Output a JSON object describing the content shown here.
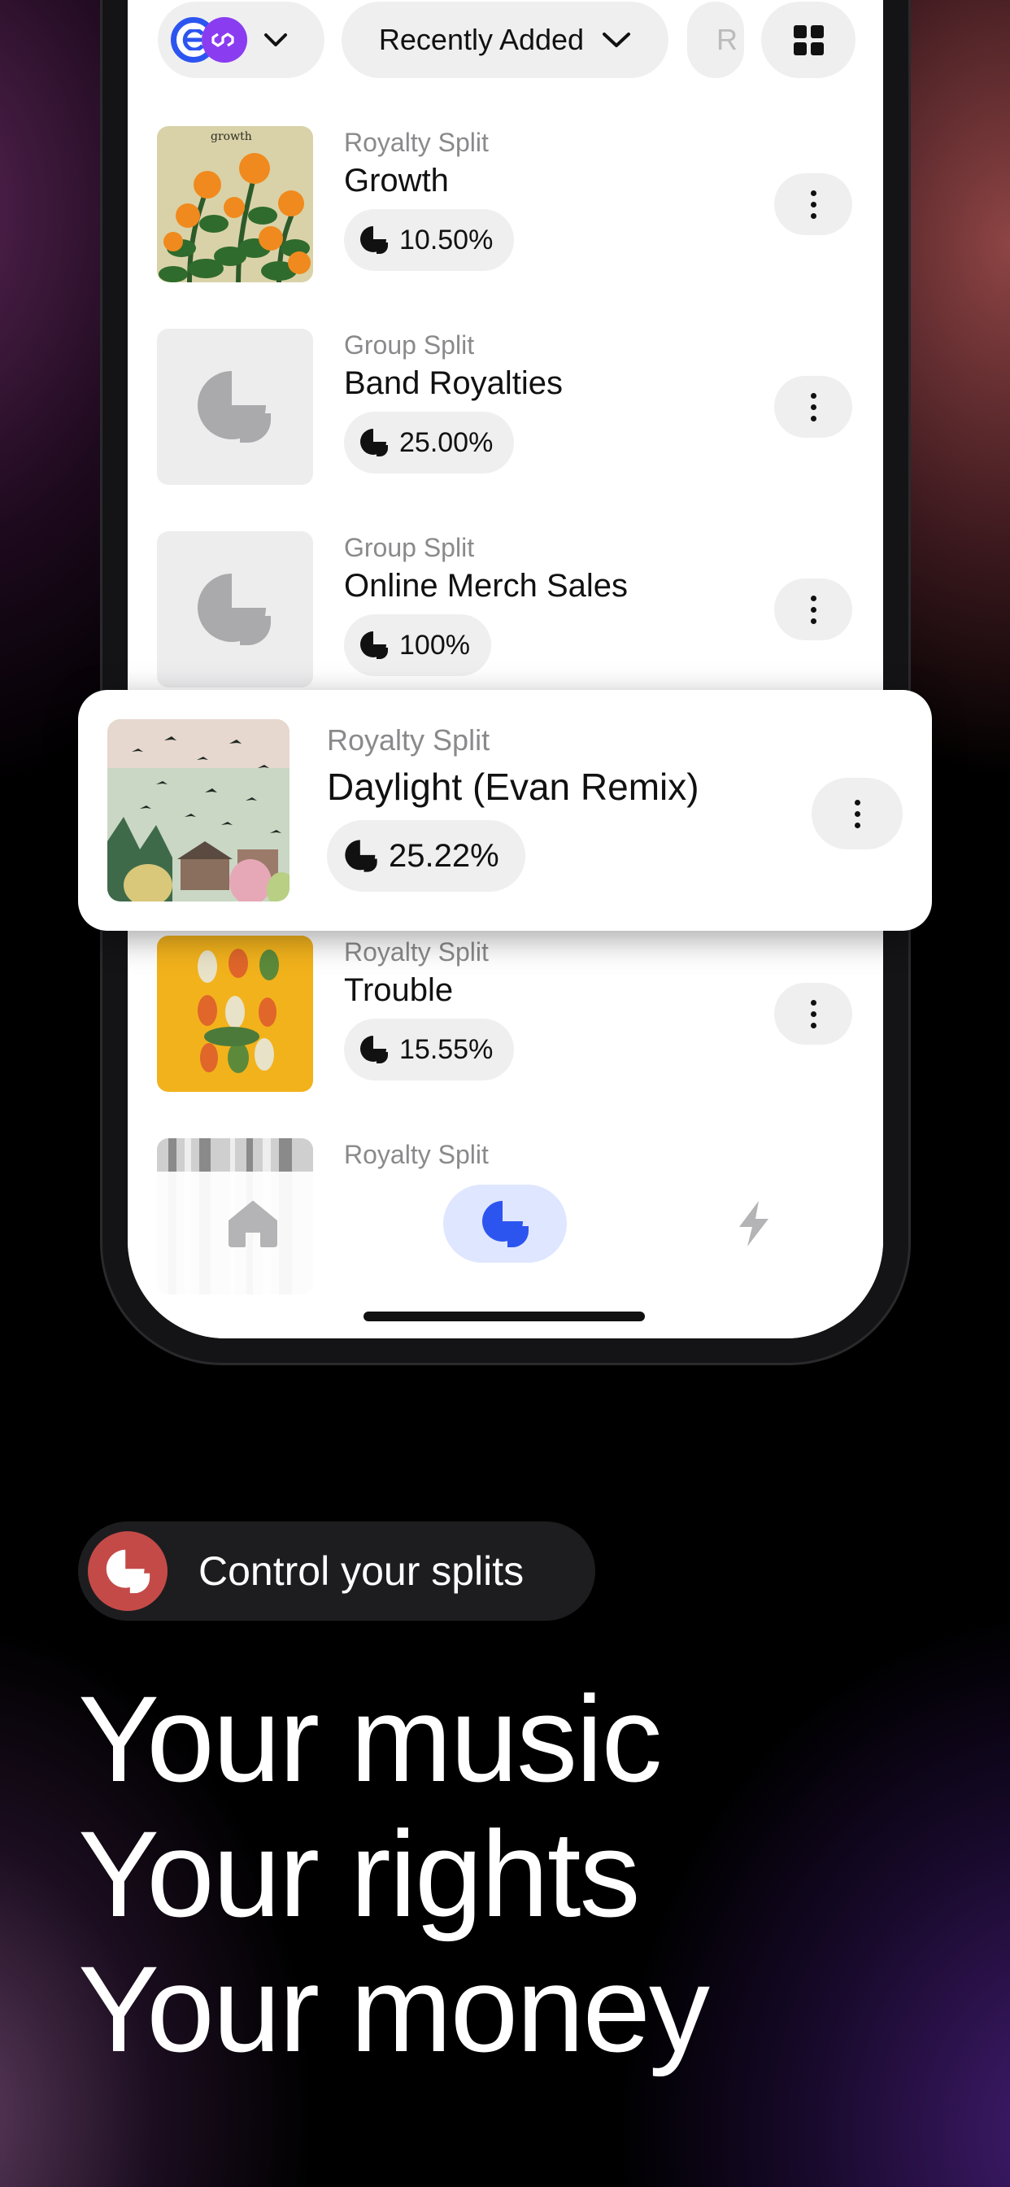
{
  "filters": {
    "currency_icons": [
      "ethereum-icon",
      "polygon-icon"
    ],
    "sort_label": "Recently Added",
    "peek_label": "R",
    "layout_icon": "grid-icon"
  },
  "splits": [
    {
      "type": "Royalty Split",
      "name": "Growth",
      "percent": "10.50%",
      "art": "growth"
    },
    {
      "type": "Group Split",
      "name": "Band Royalties",
      "percent": "25.00%",
      "art": "placeholder"
    },
    {
      "type": "Group Split",
      "name": "Online Merch Sales",
      "percent": "100%",
      "art": "placeholder"
    },
    {
      "type": "Royalty Split",
      "name": "Daylight (Evan Remix)",
      "percent": "25.22%",
      "art": "birds",
      "highlighted": true
    },
    {
      "type": "Royalty Split",
      "name": "Trouble",
      "percent": "15.55%",
      "art": "beetles"
    },
    {
      "type": "Royalty Split",
      "name": "",
      "percent": "",
      "art": "forest"
    }
  ],
  "art_text": {
    "growth": "growth"
  },
  "tabs": [
    {
      "icon": "home-icon",
      "active": false
    },
    {
      "icon": "splits-icon",
      "active": true
    },
    {
      "icon": "lightning-icon",
      "active": false
    }
  ],
  "feature_pill": {
    "label": "Control your splits",
    "icon": "splits-icon",
    "icon_color": "#c44a48"
  },
  "headline": [
    "Your music",
    "Your rights",
    "Your money"
  ],
  "colors": {
    "accent": "#2c55f0",
    "tab_active_bg": "#dfe6ff",
    "polygon": "#8a3cf0"
  }
}
